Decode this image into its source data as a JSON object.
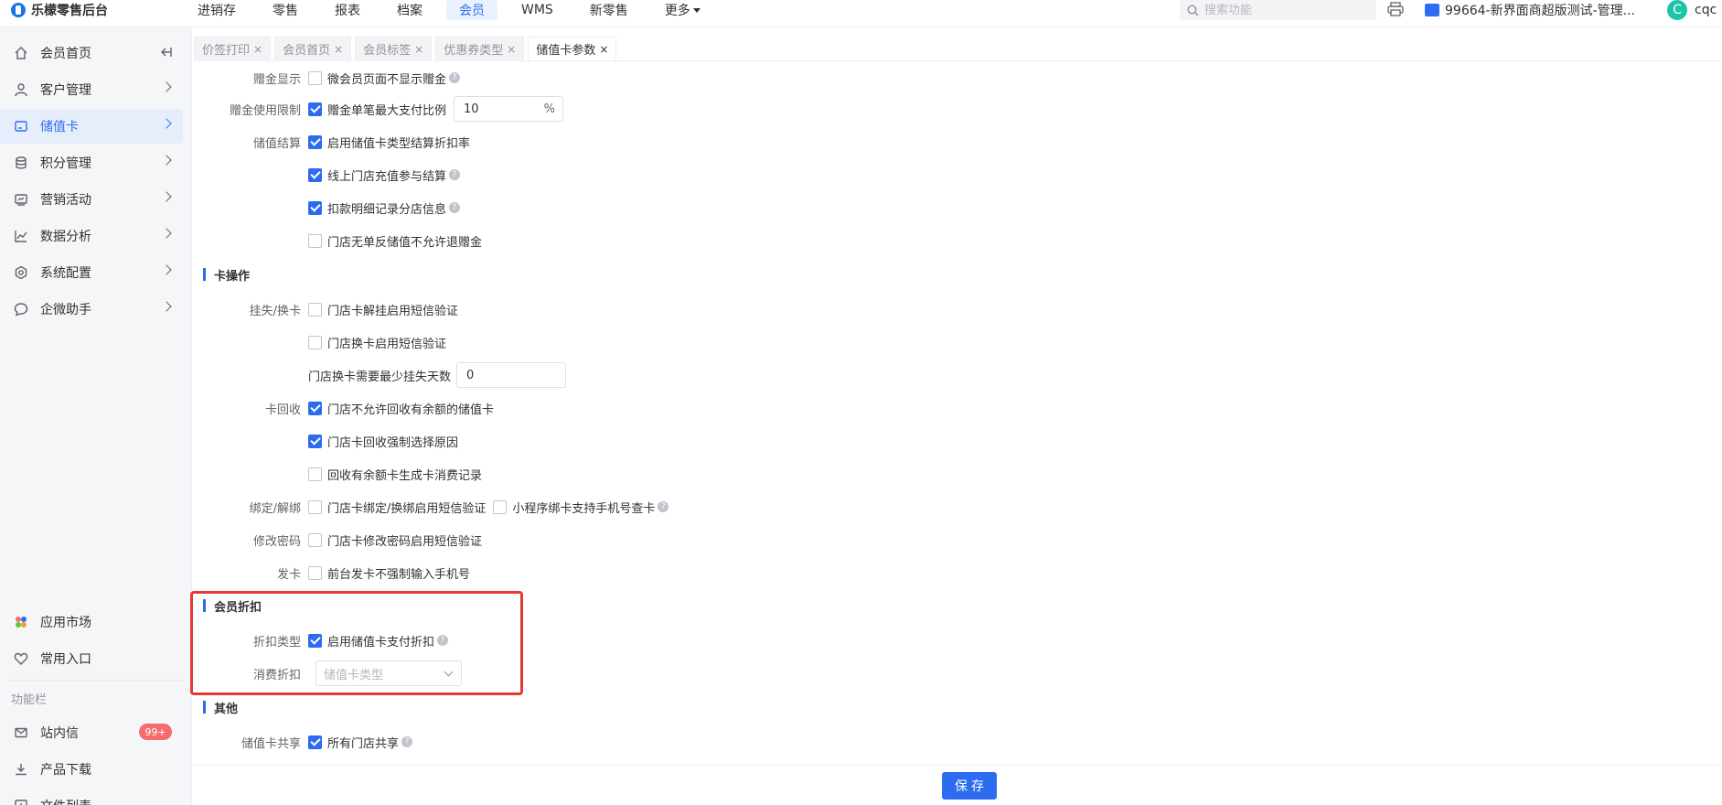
{
  "app": {
    "title": "乐檬零售后台"
  },
  "nav": {
    "items": [
      "进销存",
      "零售",
      "报表",
      "档案",
      "会员",
      "WMS",
      "新零售",
      "更多"
    ],
    "active": "会员"
  },
  "search": {
    "placeholder": "搜索功能"
  },
  "store": {
    "label": "99664-新界面商超版测试-管理..."
  },
  "user": {
    "avatar_letter": "C",
    "name": "cqc"
  },
  "sidebar": {
    "items": [
      {
        "label": "会员首页",
        "icon": "home-icon"
      },
      {
        "label": "客户管理",
        "icon": "user-icon"
      },
      {
        "label": "储值卡",
        "icon": "card-icon"
      },
      {
        "label": "积分管理",
        "icon": "coins-icon"
      },
      {
        "label": "营销活动",
        "icon": "marketing-icon"
      },
      {
        "label": "数据分析",
        "icon": "chart-icon"
      },
      {
        "label": "系统配置",
        "icon": "settings-icon"
      },
      {
        "label": "企微助手",
        "icon": "chat-icon"
      }
    ],
    "bottom": [
      {
        "label": "应用市场",
        "icon": "app-market-icon"
      },
      {
        "label": "常用入口",
        "icon": "heart-icon"
      }
    ],
    "section_label": "功能栏",
    "tools": [
      {
        "label": "站内信",
        "icon": "mail-icon",
        "badge": "99+"
      },
      {
        "label": "产品下载",
        "icon": "download-icon"
      },
      {
        "label": "文件列表",
        "icon": "file-list-icon"
      }
    ]
  },
  "tabs": [
    {
      "label": "价签打印",
      "close": "×"
    },
    {
      "label": "会员首页",
      "close": "×"
    },
    {
      "label": "会员标签",
      "close": "×"
    },
    {
      "label": "优惠券类型",
      "close": "×"
    },
    {
      "label": "储值卡参数",
      "close": "×"
    }
  ],
  "form": {
    "gift_display": {
      "label": "赠金显示",
      "option": "微会员页面不显示赠金",
      "checked": false
    },
    "gift_limit": {
      "label": "赠金使用限制",
      "option": "赠金单笔最大支付比例",
      "checked": true,
      "value": "10",
      "suffix": "%"
    },
    "settlement": {
      "label": "储值结算",
      "options": [
        {
          "text": "启用储值卡类型结算折扣率",
          "checked": true,
          "help": false
        },
        {
          "text": "线上门店充值参与结算",
          "checked": true,
          "help": true
        },
        {
          "text": "扣款明细记录分店信息",
          "checked": true,
          "help": true
        },
        {
          "text": "门店无单反储值不允许退赠金",
          "checked": false,
          "help": false
        }
      ]
    },
    "card_ops": {
      "title": "卡操作",
      "loss_label": "挂失/换卡",
      "loss_options": [
        {
          "text": "门店卡解挂启用短信验证",
          "checked": false
        },
        {
          "text": "门店换卡启用短信验证",
          "checked": false
        }
      ],
      "min_days_label": "门店换卡需要最少挂失天数",
      "min_days_value": "0",
      "recycle_label": "卡回收",
      "recycle_options": [
        {
          "text": "门店不允许回收有余额的储值卡",
          "checked": true
        },
        {
          "text": "门店卡回收强制选择原因",
          "checked": true
        },
        {
          "text": "回收有余额卡生成卡消费记录",
          "checked": false
        }
      ],
      "bind_label": "绑定/解绑",
      "bind_option_1": "门店卡绑定/换绑启用短信验证",
      "bind_option_2": "小程序绑卡支持手机号查卡",
      "password_label": "修改密码",
      "password_option": "门店卡修改密码启用短信验证",
      "issue_label": "发卡",
      "issue_option": "前台发卡不强制输入手机号"
    },
    "member_discount": {
      "title": "会员折扣",
      "type_label": "折扣类型",
      "type_option": "启用储值卡支付折扣",
      "type_checked": true,
      "consume_label": "消费折扣",
      "consume_placeholder": "储值卡类型"
    },
    "other": {
      "title": "其他",
      "share_label": "储值卡共享",
      "share_option": "所有门店共享",
      "share_checked": true
    }
  },
  "footer": {
    "save_label": "保存"
  },
  "colors": {
    "accent": "#2d6cf0",
    "highlight": "#e53935",
    "badge": "#f56c6c"
  }
}
